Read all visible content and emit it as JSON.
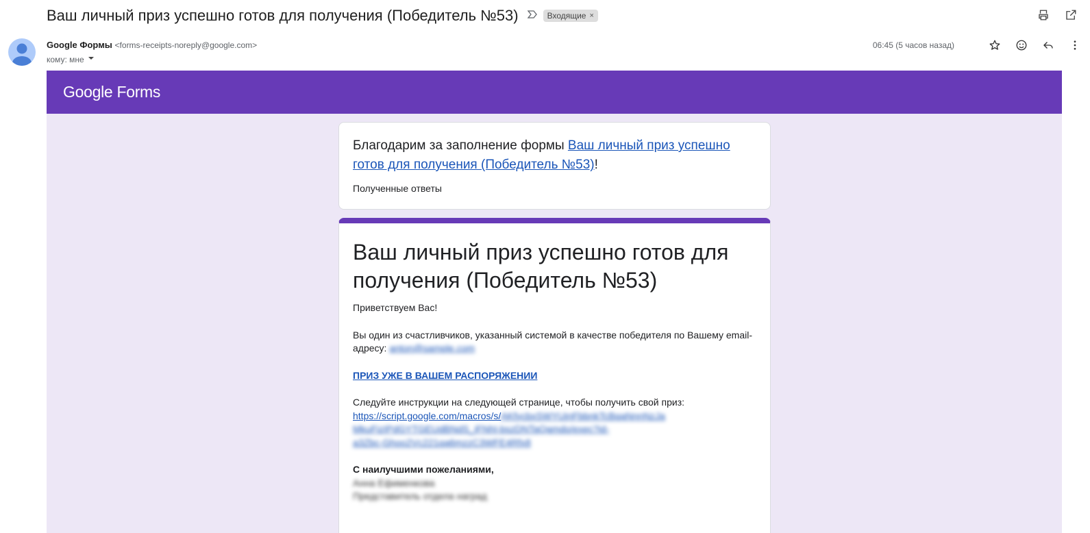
{
  "header": {
    "subject": "Ваш личный приз успешно готов для получения (Победитель №53)",
    "label": "Входящие",
    "label_remove": "×"
  },
  "message": {
    "sender_name": "Google Формы",
    "sender_email": "<forms-receipts-noreply@google.com>",
    "to_label": "кому: мне",
    "time": "06:45 (5 часов назад)"
  },
  "icons": {
    "top": [
      "importance-marker-icon",
      "print-icon",
      "open-in-new-window-icon"
    ],
    "actions": [
      "star-icon",
      "emoji-icon",
      "reply-icon",
      "more-vert-icon"
    ]
  },
  "forms_logo": "Google Forms",
  "card1": {
    "thanks_prefix": "Благодарим за заполнение формы ",
    "thanks_link": "Ваш личный приз успешно готов для получения (Победитель №53)",
    "thanks_suffix": "!",
    "received": "Полученные ответы"
  },
  "card2": {
    "title": "Ваш личный приз успешно готов для получения (Победитель №53)",
    "greeting": "Приветствуем Вас!",
    "para1": "Вы один из счастливчиков, указанный системой в качестве победителя по Вашему email-адресу: ",
    "email_blurred": "anton@sample.com",
    "prize_link": "ПРИЗ УЖЕ В ВАШЕМ РАСПОРЯЖЕНИИ",
    "instructions": "Следуйте инструкции на следующей странице, чтобы получить свой приз:",
    "script_url_visible": "https://script.google.com/macros/s/",
    "script_url_blurred_1": "AKfycbxSWYUjnFbbnkTcBqaNnnNzJa",
    "script_url_blurred_2": "MkuFizIPdGYTGEUdBNdS_jFNhl-bszDNTaQamdo/exec?id-",
    "script_url_blurred_3": "a3Zbc-Ghoo2Vc221qa6mzzC3WFE4Rfx8",
    "closing": "С наилучшими пожеланиями,",
    "signature_blurred_1": "Анна Ефименкова",
    "signature_blurred_2": "Представитель отдела наград"
  }
}
